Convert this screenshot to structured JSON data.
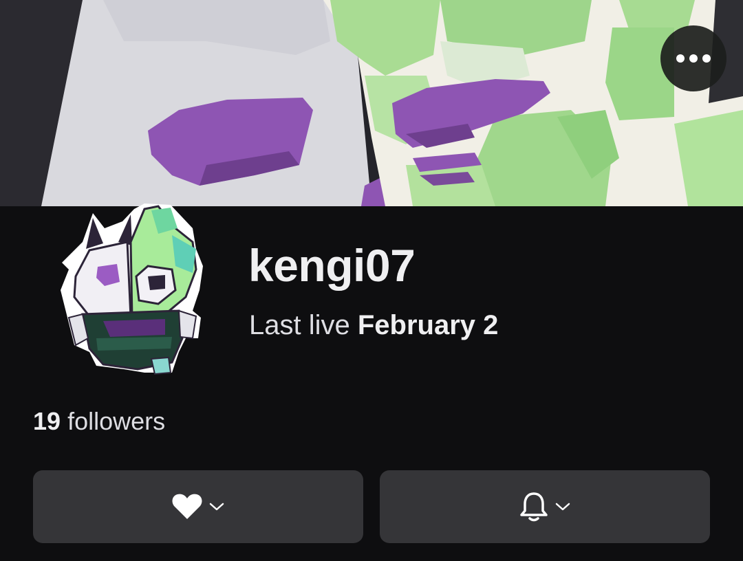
{
  "profile": {
    "channel_name": "kengi07",
    "last_live_label": "Last live",
    "last_live_date": "February 2",
    "followers_count": "19",
    "followers_label": "followers"
  },
  "icons": {
    "more": "more-options-icon",
    "follow": "heart-icon",
    "notify": "bell-icon",
    "dropdown": "chevron-down-icon"
  },
  "colors": {
    "background": "#0e0e10",
    "button_background": "#353538",
    "text_primary": "#efeff1",
    "banner_purple": "#8e55b3",
    "banner_green": "#b0e29a"
  }
}
